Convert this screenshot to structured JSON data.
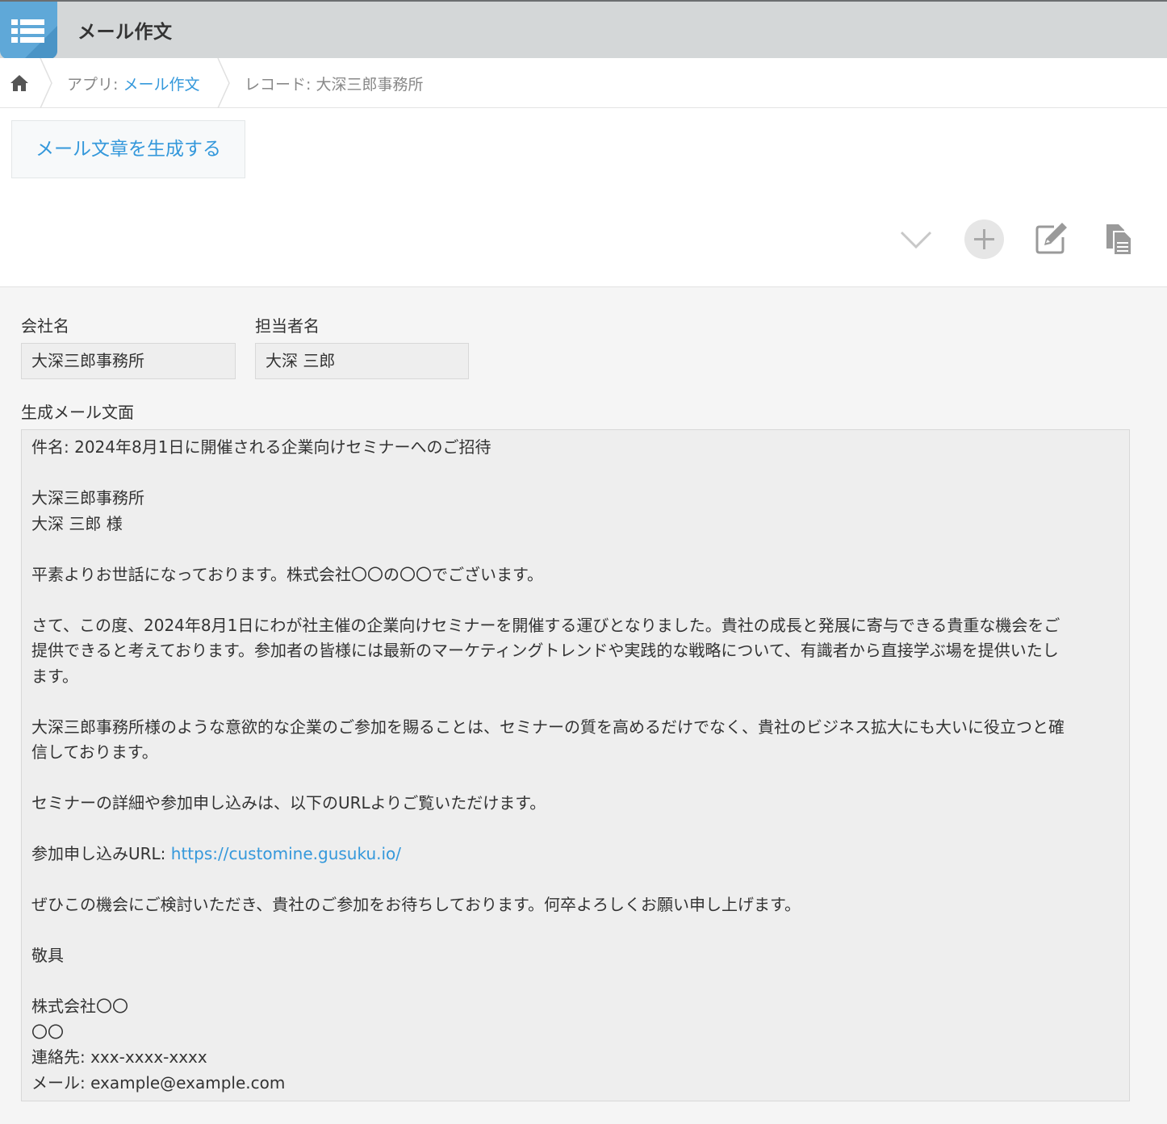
{
  "header": {
    "app_title": "メール作文",
    "app_icon": "list-icon"
  },
  "breadcrumb": {
    "home_icon": "home-icon",
    "app_prefix": "アプリ: ",
    "app_link": "メール作文",
    "record": "レコード: 大深三郎事務所"
  },
  "actions": {
    "generate_label": "メール文章を生成する",
    "tools": [
      "chevron-down-icon",
      "plus-icon",
      "edit-icon",
      "copy-icon"
    ]
  },
  "fields": {
    "company": {
      "label": "会社名",
      "value": "大深三郎事務所"
    },
    "person": {
      "label": "担当者名",
      "value": "大深 三郎"
    },
    "mail": {
      "label": "生成メール文面",
      "lines": [
        "件名: 2024年8月1日に開催される企業向けセミナーへのご招待",
        "",
        "大深三郎事務所",
        "大深 三郎 様",
        "",
        "平素よりお世話になっております。株式会社〇〇の〇〇でございます。",
        "",
        "さて、この度、2024年8月1日にわが社主催の企業向けセミナーを開催する運びとなりました。貴社の成長と発展に寄与できる貴重な機会をご",
        "提供できると考えております。参加者の皆様には最新のマーケティングトレンドや実践的な戦略について、有識者から直接学ぶ場を提供いたし",
        "ます。",
        "",
        "大深三郎事務所様のような意欲的な企業のご参加を賜ることは、セミナーの質を高めるだけでなく、貴社のビジネス拡大にも大いに役立つと確",
        "信しております。",
        "",
        "セミナーの詳細や参加申し込みは、以下のURLよりご覧いただけます。",
        "",
        "参加申し込みURL: ",
        "",
        "ぜひこの機会にご検討いただき、貴社のご参加をお待ちしております。何卒よろしくお願い申し上げます。",
        "",
        "敬具",
        "",
        "株式会社〇〇",
        "〇〇",
        "連絡先: xxx-xxxx-xxxx",
        "メール: example@example.com"
      ],
      "url": "https://customine.gusuku.io/"
    }
  },
  "colors": {
    "accent": "#3498db",
    "header_bg": "#d4d7d8",
    "icon_bg": "#5fa8d8",
    "field_bg": "#eeeeee"
  }
}
